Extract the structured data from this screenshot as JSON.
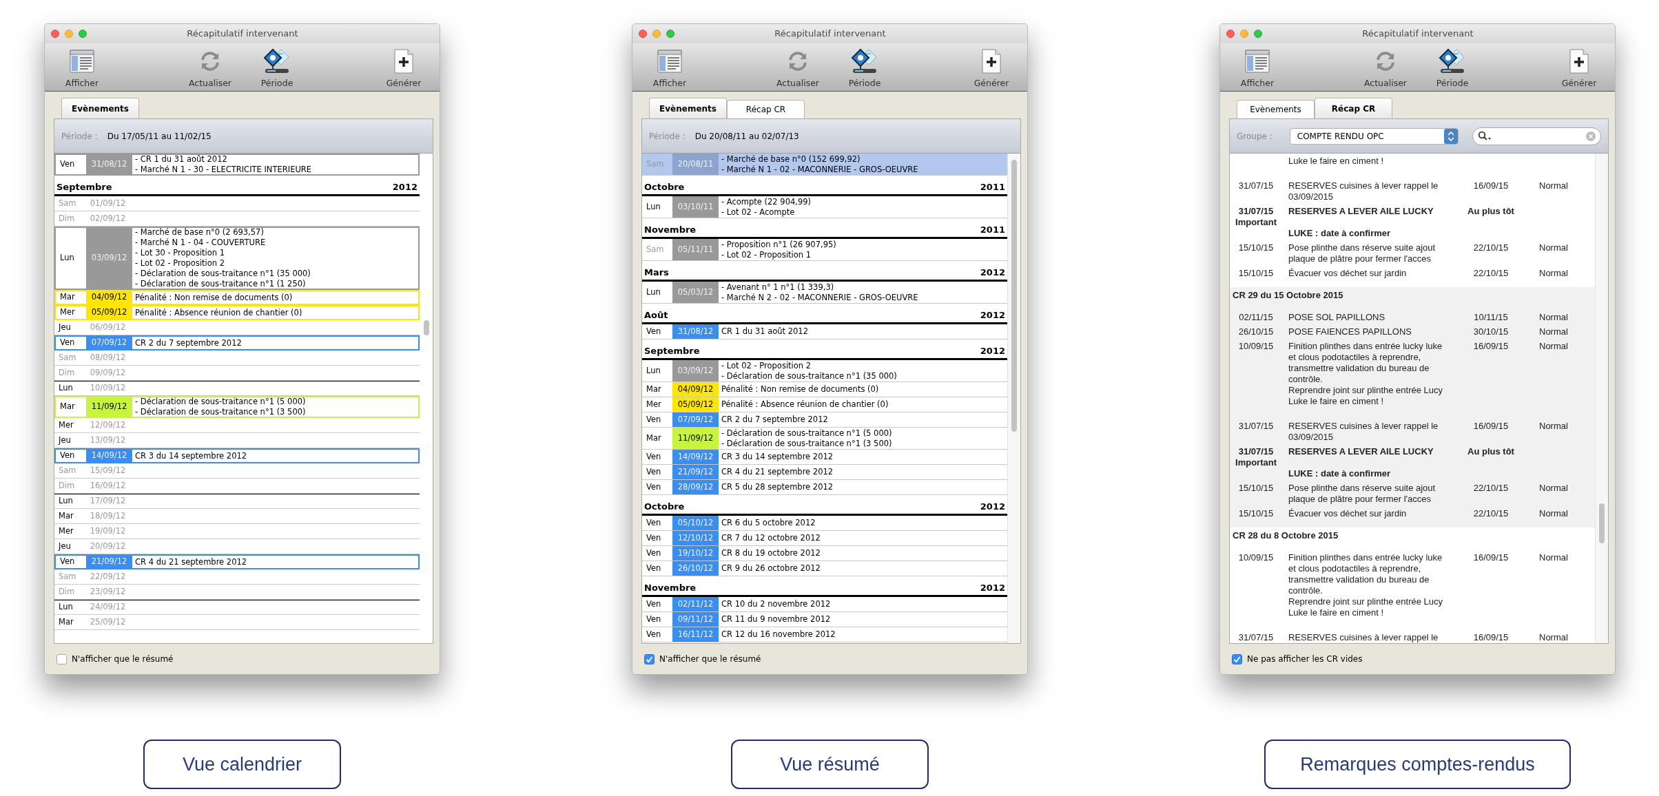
{
  "windows": [
    {
      "title": "Récapitulatif intervenant",
      "toolbar": [
        {
          "label": "Afficher",
          "kind": "display"
        },
        {
          "label": "Actualiser",
          "kind": "refresh"
        },
        {
          "label": "Période",
          "kind": "period"
        },
        {
          "label": "Générer",
          "kind": "generate"
        }
      ],
      "tabs": [
        {
          "label": "Evènements",
          "selected": true
        }
      ],
      "header": {
        "kind": "period",
        "label": "Période :",
        "value": "Du 17/05/11 au 11/02/15"
      },
      "list": {
        "kind": "calendar",
        "outlined": true,
        "entries": [
          {
            "kind": "day",
            "day": "Ven",
            "date": "31/08/12",
            "color": "#999999",
            "dimmed": false,
            "selected": false,
            "week_start": false,
            "lines": [
              "- CR 1 du 31 août 2012",
              "- Marché N 1 - 30 - ELECTRICITE INTERIEURE"
            ]
          },
          {
            "kind": "month",
            "month": "Septembre",
            "year": "2012"
          },
          {
            "kind": "day",
            "day": "Sam",
            "date": "01/09/12",
            "dimmed": true,
            "selected": false,
            "week_start": false
          },
          {
            "kind": "day",
            "day": "Dim",
            "date": "02/09/12",
            "dimmed": true,
            "selected": false,
            "week_start": false
          },
          {
            "kind": "day",
            "day": "Lun",
            "date": "03/09/12",
            "color": "#999999",
            "dimmed": false,
            "selected": false,
            "week_start": false,
            "lines": [
              "- Marché de base n°0 (2 693,57)",
              "- Marché N 1 - 04 - COUVERTURE",
              "- Lot 30 - Proposition 1",
              "- Lot 02 - Proposition 2",
              "- Déclaration de sous-traitance n°1 (35 000)",
              "- Déclaration de sous-traitance n°1 (1 250)"
            ]
          },
          {
            "kind": "day",
            "day": "Mar",
            "date": "04/09/12",
            "color": "#ffe600",
            "dimmed": false,
            "selected": false,
            "week_start": false,
            "lines": [
              "Pénalité : Non remise de documents (0)"
            ]
          },
          {
            "kind": "day",
            "day": "Mer",
            "date": "05/09/12",
            "color": "#ffe600",
            "dimmed": false,
            "selected": false,
            "week_start": false,
            "lines": [
              "Pénalité : Absence réunion de chantier (0)"
            ]
          },
          {
            "kind": "day",
            "day": "Jeu",
            "date": "06/09/12",
            "dimmed": false,
            "selected": false,
            "week_start": false
          },
          {
            "kind": "day",
            "day": "Ven",
            "date": "07/09/12",
            "color": "#3a8ef0",
            "dimmed": false,
            "selected": false,
            "week_start": false,
            "lines": [
              "CR 2 du 7 septembre 2012"
            ]
          },
          {
            "kind": "day",
            "day": "Sam",
            "date": "08/09/12",
            "dimmed": true,
            "selected": false,
            "week_start": false
          },
          {
            "kind": "day",
            "day": "Dim",
            "date": "09/09/12",
            "dimmed": true,
            "selected": false,
            "week_start": false
          },
          {
            "kind": "day",
            "day": "Lun",
            "date": "10/09/12",
            "dimmed": false,
            "selected": false,
            "week_start": true
          },
          {
            "kind": "day",
            "day": "Mar",
            "date": "11/09/12",
            "color": "#c8f53c",
            "dimmed": false,
            "selected": false,
            "week_start": false,
            "lines": [
              "- Déclaration de sous-traitance n°1 (5 000)",
              "- Déclaration de sous-traitance n°1 (3 500)"
            ]
          },
          {
            "kind": "day",
            "day": "Mer",
            "date": "12/09/12",
            "dimmed": false,
            "selected": false,
            "week_start": false
          },
          {
            "kind": "day",
            "day": "Jeu",
            "date": "13/09/12",
            "dimmed": false,
            "selected": false,
            "week_start": false
          },
          {
            "kind": "day",
            "day": "Ven",
            "date": "14/09/12",
            "color": "#3a8ef0",
            "dimmed": false,
            "selected": false,
            "week_start": false,
            "lines": [
              "CR 3 du 14 septembre 2012"
            ]
          },
          {
            "kind": "day",
            "day": "Sam",
            "date": "15/09/12",
            "dimmed": true,
            "selected": false,
            "week_start": false
          },
          {
            "kind": "day",
            "day": "Dim",
            "date": "16/09/12",
            "dimmed": true,
            "selected": false,
            "week_start": false
          },
          {
            "kind": "day",
            "day": "Lun",
            "date": "17/09/12",
            "dimmed": false,
            "selected": false,
            "week_start": true
          },
          {
            "kind": "day",
            "day": "Mar",
            "date": "18/09/12",
            "dimmed": false,
            "selected": false,
            "week_start": false
          },
          {
            "kind": "day",
            "day": "Mer",
            "date": "19/09/12",
            "dimmed": false,
            "selected": false,
            "week_start": false
          },
          {
            "kind": "day",
            "day": "Jeu",
            "date": "20/09/12",
            "dimmed": false,
            "selected": false,
            "week_start": false
          },
          {
            "kind": "day",
            "day": "Ven",
            "date": "21/09/12",
            "color": "#3a8ef0",
            "dimmed": false,
            "selected": false,
            "week_start": false,
            "lines": [
              "CR 4 du 21 septembre 2012"
            ]
          },
          {
            "kind": "day",
            "day": "Sam",
            "date": "22/09/12",
            "dimmed": true,
            "selected": false,
            "week_start": false
          },
          {
            "kind": "day",
            "day": "Dim",
            "date": "23/09/12",
            "dimmed": true,
            "selected": false,
            "week_start": false
          },
          {
            "kind": "day",
            "day": "Lun",
            "date": "24/09/12",
            "dimmed": false,
            "selected": false,
            "week_start": true
          },
          {
            "kind": "day",
            "day": "Mar",
            "date": "25/09/12",
            "dimmed": false,
            "selected": false,
            "week_start": false
          }
        ]
      },
      "checkbox": {
        "label": "N'afficher que le résumé",
        "checked": false
      },
      "caption": "Vue calendrier"
    },
    {
      "title": "Récapitulatif intervenant",
      "toolbar": [
        {
          "label": "Afficher",
          "kind": "display"
        },
        {
          "label": "Actualiser",
          "kind": "refresh"
        },
        {
          "label": "Période",
          "kind": "period"
        },
        {
          "label": "Générer",
          "kind": "generate"
        }
      ],
      "tabs": [
        {
          "label": "Evènements",
          "selected": true
        },
        {
          "label": "Récap CR",
          "selected": false
        }
      ],
      "header": {
        "kind": "period",
        "label": "Période :",
        "value": "Du 20/08/11 au 02/07/13"
      },
      "list": {
        "kind": "calendar",
        "outlined": false,
        "entries": [
          {
            "kind": "day",
            "day": "Sam",
            "date": "20/08/11",
            "color": "#8da4ce",
            "dimmed": true,
            "selected": true,
            "lines": [
              "- Marché de base n°0 (152 699,92)",
              "- Marché N 1 - 02 - MACONNERIE - GROS-OEUVRE"
            ]
          },
          {
            "kind": "month",
            "month": "Octobre",
            "year": "2011"
          },
          {
            "kind": "day",
            "day": "Lun",
            "date": "03/10/11",
            "color": "#999999",
            "dimmed": false,
            "selected": false,
            "lines": [
              "- Acompte (22 904,99)",
              "- Lot 02 - Acompte"
            ]
          },
          {
            "kind": "month",
            "month": "Novembre",
            "year": "2011"
          },
          {
            "kind": "day",
            "day": "Sam",
            "date": "05/11/11",
            "color": "#999999",
            "dimmed": true,
            "selected": false,
            "lines": [
              "- Proposition n°1 (26 907,95)",
              "- Lot 02 - Proposition 1"
            ]
          },
          {
            "kind": "month",
            "month": "Mars",
            "year": "2012"
          },
          {
            "kind": "day",
            "day": "Lun",
            "date": "05/03/12",
            "color": "#999999",
            "dimmed": false,
            "selected": false,
            "lines": [
              "- Avenant n° 1 n°1 (1 339,3)",
              "- Marché N 2 - 02 - MACONNERIE - GROS-OEUVRE"
            ]
          },
          {
            "kind": "month",
            "month": "Août",
            "year": "2012"
          },
          {
            "kind": "day",
            "day": "Ven",
            "date": "31/08/12",
            "color": "#3a8ef0",
            "dimmed": false,
            "selected": false,
            "lines": [
              "CR 1 du 31 août 2012"
            ]
          },
          {
            "kind": "month",
            "month": "Septembre",
            "year": "2012"
          },
          {
            "kind": "day",
            "day": "Lun",
            "date": "03/09/12",
            "color": "#999999",
            "dimmed": false,
            "selected": false,
            "lines": [
              "- Lot 02 - Proposition 2",
              "- Déclaration de sous-traitance n°1 (35 000)"
            ]
          },
          {
            "kind": "day",
            "day": "Mar",
            "date": "04/09/12",
            "color": "#ffe600",
            "dimmed": false,
            "selected": false,
            "lines": [
              "Pénalité : Non remise de documents (0)"
            ]
          },
          {
            "kind": "day",
            "day": "Mer",
            "date": "05/09/12",
            "color": "#ffe600",
            "dimmed": false,
            "selected": false,
            "lines": [
              "Pénalité : Absence réunion de chantier (0)"
            ]
          },
          {
            "kind": "day",
            "day": "Ven",
            "date": "07/09/12",
            "color": "#3a8ef0",
            "dimmed": false,
            "selected": false,
            "lines": [
              "CR 2 du 7 septembre 2012"
            ]
          },
          {
            "kind": "day",
            "day": "Mar",
            "date": "11/09/12",
            "color": "#c8f53c",
            "dimmed": false,
            "selected": false,
            "lines": [
              "- Déclaration de sous-traitance n°1 (5 000)",
              "- Déclaration de sous-traitance n°1 (3 500)"
            ]
          },
          {
            "kind": "day",
            "day": "Ven",
            "date": "14/09/12",
            "color": "#3a8ef0",
            "dimmed": false,
            "selected": false,
            "lines": [
              "CR 3 du 14 septembre 2012"
            ]
          },
          {
            "kind": "day",
            "day": "Ven",
            "date": "21/09/12",
            "color": "#3a8ef0",
            "dimmed": false,
            "selected": false,
            "lines": [
              "CR 4 du 21 septembre 2012"
            ]
          },
          {
            "kind": "day",
            "day": "Ven",
            "date": "28/09/12",
            "color": "#3a8ef0",
            "dimmed": false,
            "selected": false,
            "lines": [
              "CR 5 du 28 septembre 2012"
            ]
          },
          {
            "kind": "month",
            "month": "Octobre",
            "year": "2012"
          },
          {
            "kind": "day",
            "day": "Ven",
            "date": "05/10/12",
            "color": "#3a8ef0",
            "dimmed": false,
            "selected": false,
            "lines": [
              "CR 6 du 5 octobre 2012"
            ]
          },
          {
            "kind": "day",
            "day": "Ven",
            "date": "12/10/12",
            "color": "#3a8ef0",
            "dimmed": false,
            "selected": false,
            "lines": [
              "CR 7 du 12 octobre 2012"
            ]
          },
          {
            "kind": "day",
            "day": "Ven",
            "date": "19/10/12",
            "color": "#3a8ef0",
            "dimmed": false,
            "selected": false,
            "lines": [
              "CR 8 du 19 octobre 2012"
            ]
          },
          {
            "kind": "day",
            "day": "Ven",
            "date": "26/10/12",
            "color": "#3a8ef0",
            "dimmed": false,
            "selected": false,
            "lines": [
              "CR 9 du 26 octobre 2012"
            ]
          },
          {
            "kind": "month",
            "month": "Novembre",
            "year": "2012"
          },
          {
            "kind": "day",
            "day": "Ven",
            "date": "02/11/12",
            "color": "#3a8ef0",
            "dimmed": false,
            "selected": false,
            "lines": [
              "CR 10 du 2 novembre 2012"
            ]
          },
          {
            "kind": "day",
            "day": "Ven",
            "date": "09/11/12",
            "color": "#3a8ef0",
            "dimmed": false,
            "selected": false,
            "lines": [
              "CR 11 du 9 novembre 2012"
            ]
          },
          {
            "kind": "day",
            "day": "Ven",
            "date": "16/11/12",
            "color": "#3a8ef0",
            "dimmed": false,
            "selected": false,
            "lines": [
              "CR 12 du 16 novembre 2012"
            ]
          }
        ]
      },
      "checkbox": {
        "label": "N'afficher que le résumé",
        "checked": true
      },
      "caption": "Vue résumé"
    },
    {
      "title": "Récapitulatif intervenant",
      "toolbar": [
        {
          "label": "Afficher",
          "kind": "display"
        },
        {
          "label": "Actualiser",
          "kind": "refresh"
        },
        {
          "label": "Période",
          "kind": "period"
        },
        {
          "label": "Générer",
          "kind": "generate"
        }
      ],
      "tabs": [
        {
          "label": "Evènements",
          "selected": false
        },
        {
          "label": "Récap CR",
          "selected": true
        }
      ],
      "header": {
        "kind": "group",
        "label": "Groupe :",
        "value": "COMPTE RENDU OPC"
      },
      "list": {
        "kind": "remarks",
        "sections": [
          {
            "shaded": false,
            "remarks": [
              {
                "kind": "continuation",
                "lines": [
                  "Luke le faire en ciment !"
                ]
              },
              {
                "kind": "remark",
                "date": "31/07/15",
                "lines": [
                  "RESERVES cuisines à lever rappel le",
                  "03/09/2015"
                ],
                "due": "16/09/15",
                "priority": "Normal",
                "important": false
              },
              {
                "kind": "remark",
                "date": "31/07/15",
                "flag": "Important",
                "lines": [
                  "RESERVES A LEVER AILE LUCKY",
                  "LUKE : date à confirmer"
                ],
                "due": "Au plus tôt",
                "important": true
              },
              {
                "kind": "remark",
                "date": "15/10/15",
                "lines": [
                  "Pose plinthe dans réserve suite ajout",
                  "plaque de plâtre pour fermer l'acces"
                ],
                "due": "22/10/15",
                "priority": "Normal",
                "important": false
              },
              {
                "kind": "remark",
                "date": "15/10/15",
                "lines": [
                  "Évacuer vos déchet sur jardin"
                ],
                "due": "22/10/15",
                "priority": "Normal",
                "important": false
              }
            ]
          },
          {
            "title": "CR 29 du 15 Octobre 2015",
            "shaded": true,
            "remarks": [
              {
                "kind": "remark",
                "date": "02/11/15",
                "lines": [
                  "POSE SOL PAPILLONS"
                ],
                "due": "10/11/15",
                "priority": "Normal",
                "important": false
              },
              {
                "kind": "remark",
                "date": "26/10/15",
                "lines": [
                  "POSE FAIENCES PAPILLONS"
                ],
                "due": "30/10/15",
                "priority": "Normal",
                "important": false
              },
              {
                "kind": "remark",
                "date": "10/09/15",
                "lines": [
                  "Finition plinthes dans entrée lucky luke",
                  "et clous podotactiles à reprendre,",
                  "transmettre validation du bureau de",
                  "contrôle.",
                  "Reprendre joint sur plinthe entrée Lucy",
                  "Luke le faire en ciment !"
                ],
                "due": "16/09/15",
                "priority": "Normal",
                "important": false
              },
              {
                "kind": "remark",
                "date": "31/07/15",
                "lines": [
                  "RESERVES cuisines à lever rappel le",
                  "03/09/2015"
                ],
                "due": "16/09/15",
                "priority": "Normal",
                "important": false
              },
              {
                "kind": "remark",
                "date": "31/07/15",
                "flag": "Important",
                "lines": [
                  "RESERVES A LEVER AILE LUCKY",
                  "LUKE : date à confirmer"
                ],
                "due": "Au plus tôt",
                "important": true
              },
              {
                "kind": "remark",
                "date": "15/10/15",
                "lines": [
                  "Pose plinthe dans réserve suite ajout",
                  "plaque de plâtre pour fermer l'acces"
                ],
                "due": "22/10/15",
                "priority": "Normal",
                "important": false
              },
              {
                "kind": "remark",
                "date": "15/10/15",
                "lines": [
                  "Évacuer vos déchet sur jardin"
                ],
                "due": "22/10/15",
                "priority": "Normal",
                "important": false
              }
            ]
          },
          {
            "title": "CR 28 du 8 Octobre 2015",
            "shaded": false,
            "remarks": [
              {
                "kind": "remark",
                "date": "10/09/15",
                "lines": [
                  "Finition plinthes dans entrée lucky luke",
                  "et clous podotactiles à reprendre,",
                  "transmettre validation du bureau de",
                  "contrôle.",
                  "Reprendre joint sur plinthe entrée Lucy",
                  "Luke le faire en ciment !"
                ],
                "due": "16/09/15",
                "priority": "Normal",
                "important": false
              },
              {
                "kind": "remark",
                "date": "31/07/15",
                "lines": [
                  "RESERVES cuisines à lever rappel le"
                ],
                "due": "16/09/15",
                "priority": "Normal",
                "important": false
              }
            ]
          }
        ]
      },
      "checkbox": {
        "label": "Ne pas afficher les CR vides",
        "checked": true
      },
      "caption": "Remarques comptes-rendus"
    }
  ]
}
